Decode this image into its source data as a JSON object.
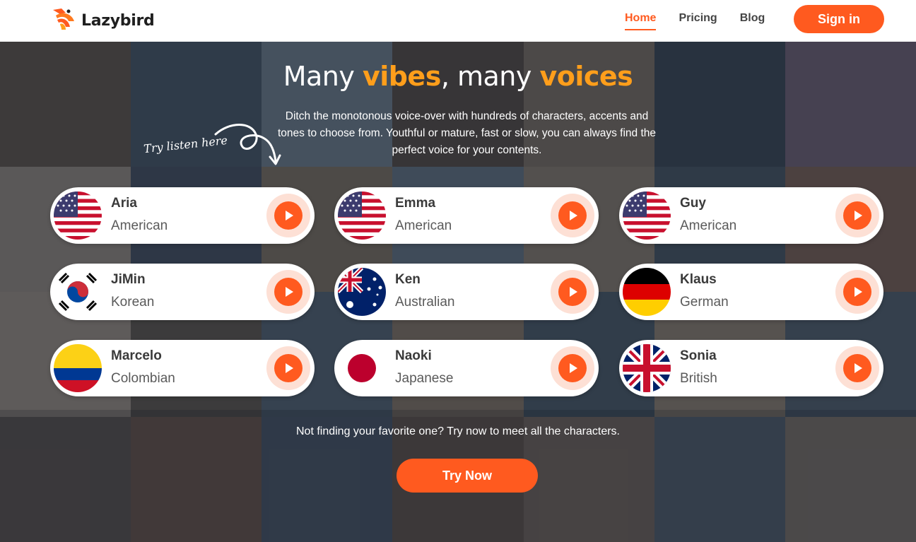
{
  "header": {
    "logo_text": "Lazybird",
    "nav": [
      {
        "label": "Home",
        "active": true
      },
      {
        "label": "Pricing",
        "active": false
      },
      {
        "label": "Blog",
        "active": false
      }
    ],
    "signin_label": "Sign in"
  },
  "hero": {
    "title_part1": "Many ",
    "title_accent1": "vibes",
    "title_part2": ", many ",
    "title_accent2": "voices",
    "subtitle": "Ditch the monotonous voice-over with hundreds of characters, accents and tones to choose from. Youthful or mature, fast or slow, you can always find the perfect voice for your contents.",
    "hint": "Try listen here"
  },
  "voices": [
    {
      "name": "Aria",
      "accent": "American",
      "flag": "us-flag-icon"
    },
    {
      "name": "Emma",
      "accent": "American",
      "flag": "us-flag-icon"
    },
    {
      "name": "Guy",
      "accent": "American",
      "flag": "us-flag-icon"
    },
    {
      "name": "JiMin",
      "accent": "Korean",
      "flag": "kr-flag-icon"
    },
    {
      "name": "Ken",
      "accent": "Australian",
      "flag": "au-flag-icon"
    },
    {
      "name": "Klaus",
      "accent": "German",
      "flag": "de-flag-icon"
    },
    {
      "name": "Marcelo",
      "accent": "Colombian",
      "flag": "co-flag-icon"
    },
    {
      "name": "Naoki",
      "accent": "Japanese",
      "flag": "jp-flag-icon"
    },
    {
      "name": "Sonia",
      "accent": "British",
      "flag": "gb-flag-icon"
    }
  ],
  "footer": {
    "prompt": "Not finding your favorite one? Try now to meet all the characters.",
    "cta_label": "Try Now"
  },
  "colors": {
    "accent": "#ff5a1f",
    "highlight": "#ff9e1b",
    "play_ring": "#fde0d5"
  }
}
